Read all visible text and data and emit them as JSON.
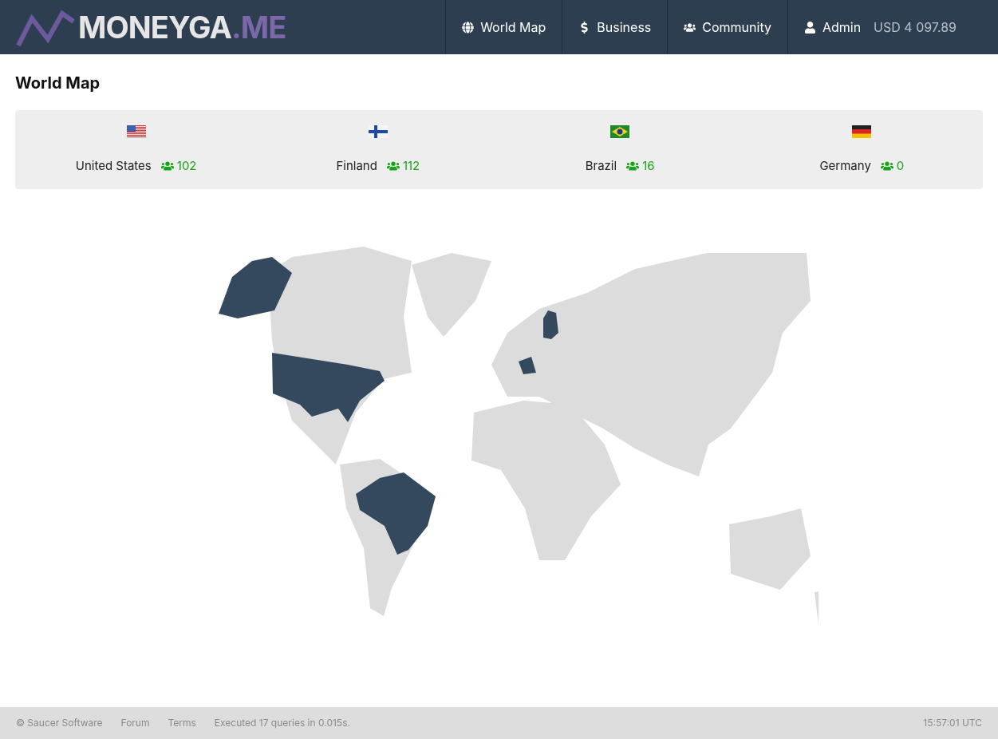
{
  "logo": {
    "name": "MONEYGA",
    "suffix": ".ME"
  },
  "nav": [
    {
      "label": "World Map",
      "kind": "globe"
    },
    {
      "label": "Business",
      "kind": "dollar"
    },
    {
      "label": "Community",
      "kind": "users"
    },
    {
      "label": "Admin",
      "kind": "user"
    }
  ],
  "balance": "USD 4 097.89",
  "page_title": "World Map",
  "countries": [
    {
      "kind": "usa",
      "name": "United States",
      "members": "102"
    },
    {
      "kind": "finland",
      "name": "Finland",
      "members": "112"
    },
    {
      "kind": "brazil",
      "name": "Brazil",
      "members": "16"
    },
    {
      "kind": "germany",
      "name": "Germany",
      "members": "0"
    }
  ],
  "footer": {
    "copyright": "© Saucer Software",
    "links": [
      "Forum",
      "Terms"
    ],
    "stats": "Executed 17 queries in 0.015s.",
    "time": "15:57:01 UTC"
  }
}
